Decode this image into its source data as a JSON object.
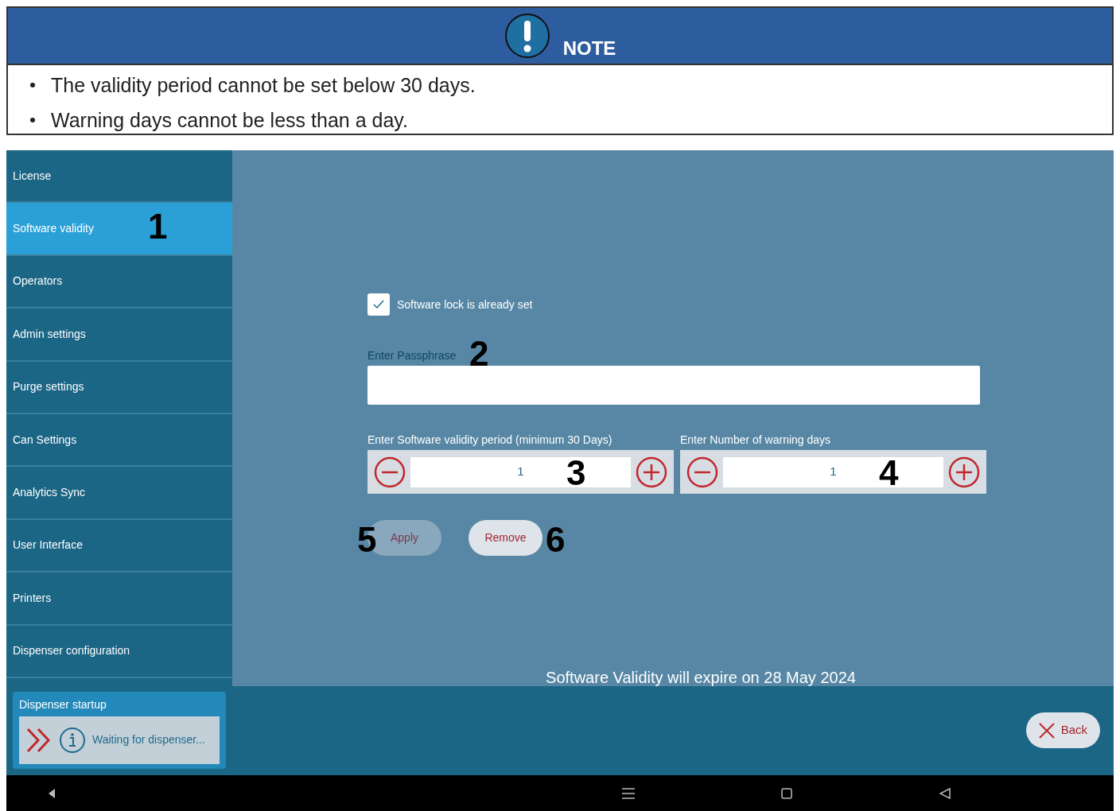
{
  "note": {
    "title": "NOTE",
    "items": [
      "The validity period cannot be set below 30 days.",
      "Warning days cannot be less than a day."
    ]
  },
  "sidebar": {
    "items": [
      {
        "label": "License",
        "selected": false
      },
      {
        "label": "Software validity",
        "selected": true,
        "callout": "1"
      },
      {
        "label": "Operators",
        "selected": false
      },
      {
        "label": "Admin settings",
        "selected": false
      },
      {
        "label": "Purge settings",
        "selected": false
      },
      {
        "label": "Can Settings",
        "selected": false
      },
      {
        "label": "Analytics Sync",
        "selected": false
      },
      {
        "label": "User Interface",
        "selected": false
      },
      {
        "label": "Printers",
        "selected": false
      },
      {
        "label": "Dispenser configuration",
        "selected": false
      }
    ]
  },
  "lock_checkbox": {
    "label": "Software lock is already set",
    "checked": true
  },
  "passphrase": {
    "placeholder": "Enter Passphrase",
    "callout": "2"
  },
  "steppers": [
    {
      "label": "Enter Software validity period (minimum 30 Days)",
      "value": "1",
      "callout": "3"
    },
    {
      "label": "Enter Number of warning days",
      "value": "1",
      "callout": "4"
    }
  ],
  "buttons": [
    {
      "label": "Apply",
      "disabled": true,
      "callout": "5"
    },
    {
      "label": "Remove",
      "disabled": false,
      "callout": "6"
    }
  ],
  "expiry": "Software Validity will expire on 28 May 2024",
  "startup": {
    "title": "Dispenser startup",
    "status": "Waiting for dispenser..."
  },
  "back_button": "Back"
}
